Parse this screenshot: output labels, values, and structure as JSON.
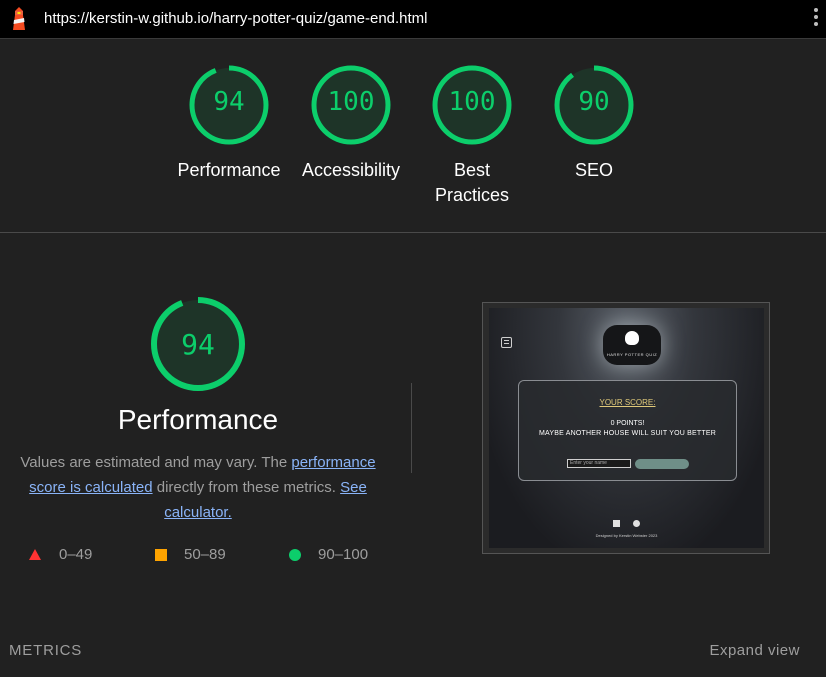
{
  "address_bar": {
    "url": "https://kerstin-w.github.io/harry-potter-quiz/game-end.html"
  },
  "score_gauges": [
    {
      "label": "Performance",
      "score": 94
    },
    {
      "label": "Accessibility",
      "score": 100
    },
    {
      "label": "Best Practices",
      "score": 100
    },
    {
      "label": "SEO",
      "score": 90
    }
  ],
  "performance": {
    "score": 94,
    "title": "Performance",
    "description_prefix": "Values are estimated and may vary. The ",
    "link_score_calculated": "performance score is calculated",
    "description_middle": " directly from these metrics. ",
    "link_calculator": "See calculator."
  },
  "legend": [
    {
      "range": "0–49",
      "color": "#ff3333",
      "shape": "triangle"
    },
    {
      "range": "50–89",
      "color": "#ffa400",
      "shape": "square"
    },
    {
      "range": "90–100",
      "color": "#0cce6b",
      "shape": "circle"
    }
  ],
  "screenshot": {
    "score_title": "YOUR SCORE:",
    "points": "0 POINTS!",
    "message": "MAYBE ANOTHER HOUSE WILL SUIT YOU BETTER",
    "input_placeholder": "Enter your name",
    "logo_text": "HARRY POTTER QUIZ",
    "footer": "Designed by Kerstin Webster 2023"
  },
  "bottom": {
    "metrics_label": "METRICS",
    "expand_label": "Expand view"
  },
  "colors": {
    "pass": "#0cce6b",
    "background": "#212121",
    "link": "#8ab4f8"
  }
}
